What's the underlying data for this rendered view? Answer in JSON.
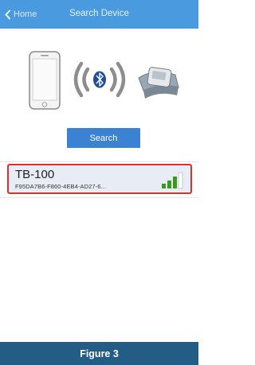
{
  "nav": {
    "back_label": "Home",
    "title": "Search Device"
  },
  "illustration": {
    "phone_icon": "smartphone-icon",
    "bluetooth_icon": "bluetooth-icon",
    "device_icon": "blood-pressure-monitor-icon"
  },
  "search_button": {
    "label": "Search"
  },
  "devices": [
    {
      "name": "TB-100",
      "uuid": "F95DA7B6-F860-4EB4-AD27-6...",
      "signal_bars": 3,
      "signal_max": 4,
      "selected": true
    }
  ],
  "caption": "Figure 3",
  "colors": {
    "nav_bg": "#4a9ae0",
    "button_bg": "#3b83d2",
    "selected_border": "#d9322b",
    "signal_green": "#3a9a1e",
    "caption_bg": "#235c84"
  }
}
